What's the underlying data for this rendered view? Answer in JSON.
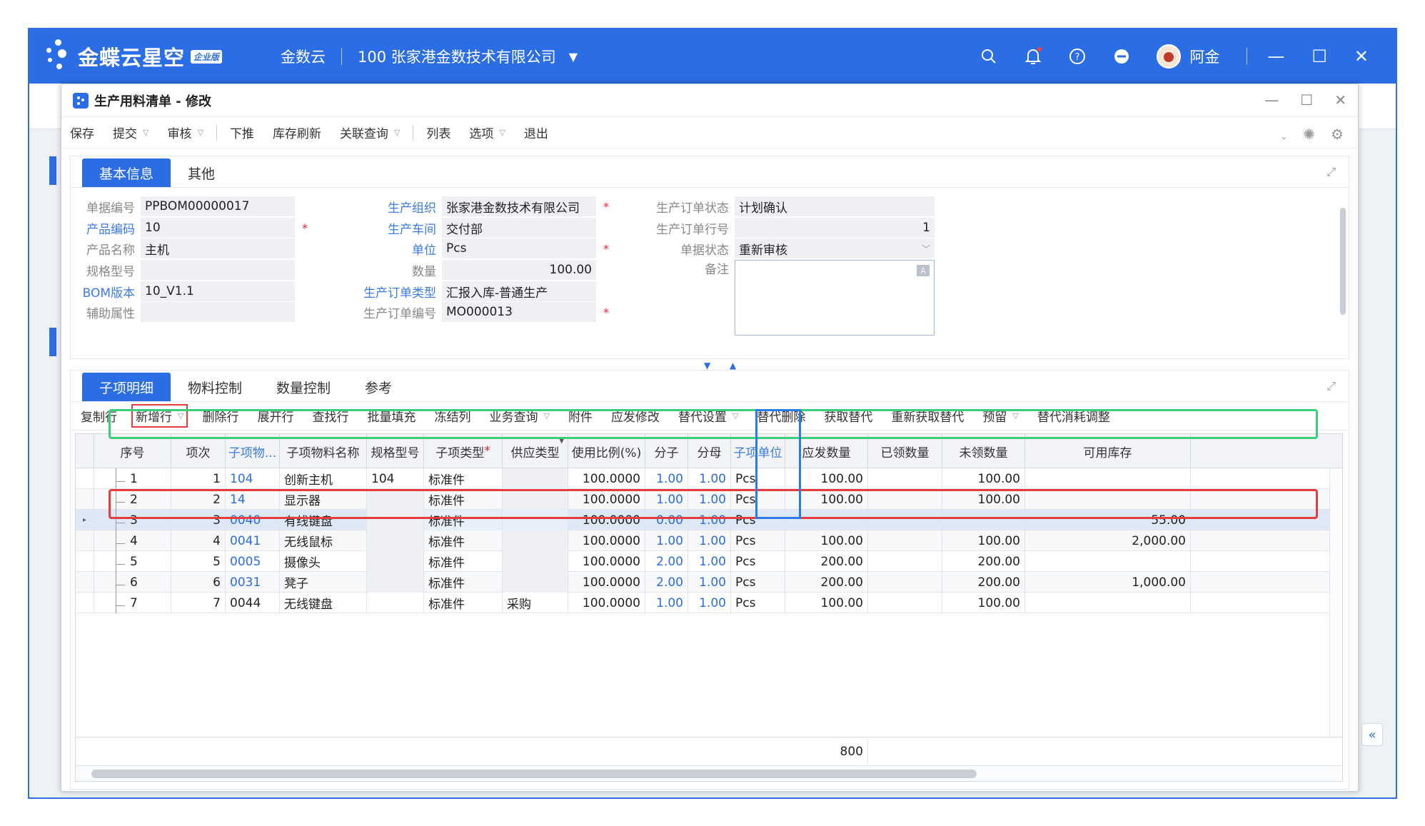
{
  "topbar": {
    "brand": "金蝶云星空",
    "edition": "企业版",
    "product": "金数云",
    "company": "100  张家港金数技术有限公司",
    "user": "阿金"
  },
  "dialog": {
    "title": "生产用料清单 - 修改"
  },
  "toolbar": {
    "items": [
      "保存",
      "提交",
      "审核",
      "下推",
      "库存刷新",
      "关联查询",
      "列表",
      "选项",
      "退出"
    ]
  },
  "header_tabs": [
    "基本信息",
    "其他"
  ],
  "form": {
    "bill_no_label": "单据编号",
    "bill_no": "PPBOM00000017",
    "product_code_label": "产品编码",
    "product_code": "10",
    "product_name_label": "产品名称",
    "product_name": "主机",
    "spec_label": "规格型号",
    "spec": "",
    "bom_label": "BOM版本",
    "bom": "10_V1.1",
    "aux_label": "辅助属性",
    "aux": "",
    "org_label": "生产组织",
    "org": "张家港金数技术有限公司",
    "workshop_label": "生产车间",
    "workshop": "交付部",
    "unit_label": "单位",
    "unit": "Pcs",
    "qty_label": "数量",
    "qty": "100.00",
    "mo_type_label": "生产订单类型",
    "mo_type": "汇报入库-普通生产",
    "mo_no_label": "生产订单编号",
    "mo_no": "MO000013",
    "mo_status_label": "生产订单状态",
    "mo_status": "计划确认",
    "mo_line_label": "生产订单行号",
    "mo_line": "1",
    "bill_status_label": "单据状态",
    "bill_status": "重新审核",
    "memo_label": "备注"
  },
  "detail_tabs": [
    "子项明细",
    "物料控制",
    "数量控制",
    "参考"
  ],
  "detail_toolbar": [
    "复制行",
    "新增行",
    "删除行",
    "展开行",
    "查找行",
    "批量填充",
    "冻结列",
    "业务查询",
    "附件",
    "应发修改",
    "替代设置",
    "替代删除",
    "获取替代",
    "重新获取替代",
    "预留",
    "替代消耗调整"
  ],
  "grid": {
    "headers": [
      "序号",
      "项次",
      "子项物...",
      "子项物料名称",
      "规格型号",
      "子项类型",
      "供应类型",
      "使用比例(%)",
      "分子",
      "分母",
      "子项单位",
      "应发数量",
      "已领数量",
      "未领数量",
      "可用库存"
    ],
    "rows": [
      {
        "seq": "1",
        "item": "1",
        "code": "104",
        "name": "创新主机",
        "spec": "104",
        "type": "标准件",
        "supply": "",
        "ratio": "100.0000",
        "num": "1.00",
        "den": "1.00",
        "unit": "Pcs",
        "must": "100.00",
        "picked": "",
        "unpicked": "100.00",
        "stock": ""
      },
      {
        "seq": "2",
        "item": "2",
        "code": "14",
        "name": "显示器",
        "spec": "",
        "type": "标准件",
        "supply": "",
        "ratio": "100.0000",
        "num": "1.00",
        "den": "1.00",
        "unit": "Pcs",
        "must": "100.00",
        "picked": "",
        "unpicked": "100.00",
        "stock": ""
      },
      {
        "seq": "3",
        "item": "3",
        "code": "0040",
        "name": "有线键盘",
        "spec": "",
        "type": "标准件",
        "supply": "",
        "ratio": "100.0000",
        "num": "0.00",
        "den": "1.00",
        "unit": "Pcs",
        "must": "",
        "picked": "",
        "unpicked": "",
        "stock": "55.00"
      },
      {
        "seq": "4",
        "item": "4",
        "code": "0041",
        "name": "无线鼠标",
        "spec": "",
        "type": "标准件",
        "supply": "",
        "ratio": "100.0000",
        "num": "1.00",
        "den": "1.00",
        "unit": "Pcs",
        "must": "100.00",
        "picked": "",
        "unpicked": "100.00",
        "stock": "2,000.00"
      },
      {
        "seq": "5",
        "item": "5",
        "code": "0005",
        "name": "摄像头",
        "spec": "",
        "type": "标准件",
        "supply": "",
        "ratio": "100.0000",
        "num": "2.00",
        "den": "1.00",
        "unit": "Pcs",
        "must": "200.00",
        "picked": "",
        "unpicked": "200.00",
        "stock": ""
      },
      {
        "seq": "6",
        "item": "6",
        "code": "0031",
        "name": "凳子",
        "spec": "",
        "type": "标准件",
        "supply": "",
        "ratio": "100.0000",
        "num": "2.00",
        "den": "1.00",
        "unit": "Pcs",
        "must": "200.00",
        "picked": "",
        "unpicked": "200.00",
        "stock": "1,000.00"
      },
      {
        "seq": "7",
        "item": "7",
        "code": "0044",
        "name": "无线键盘",
        "spec": "",
        "type": "标准件",
        "supply": "采购",
        "ratio": "100.0000",
        "num": "1.00",
        "den": "1.00",
        "unit": "Pcs",
        "must": "100.00",
        "picked": "",
        "unpicked": "100.00",
        "stock": ""
      }
    ],
    "total_must": "800"
  },
  "colors": {
    "accent": "#2b6de5",
    "highlight_green": "#3bcf7a",
    "highlight_red": "#e53d3d"
  }
}
